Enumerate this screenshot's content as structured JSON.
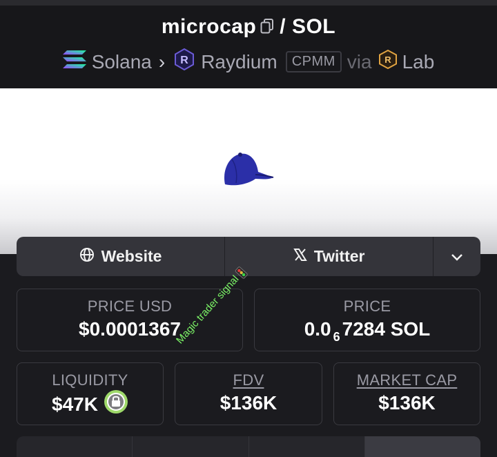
{
  "pair": {
    "base": "microcap",
    "separator": "/",
    "quote": "SOL"
  },
  "breadcrumb": {
    "chain": "Solana",
    "dex": "Raydium",
    "pool_type": "CPMM",
    "via_label": "via",
    "launchpad": "Lab"
  },
  "links": {
    "website_label": "Website",
    "twitter_label": "Twitter"
  },
  "stats": {
    "price_usd": {
      "label": "PRICE USD",
      "value": "$0.0001367"
    },
    "price": {
      "label": "PRICE",
      "value_prefix": "0.0",
      "value_subscript": "6",
      "value_suffix": "7284 SOL"
    },
    "liquidity": {
      "label": "LIQUIDITY",
      "value": "$47K"
    },
    "fdv": {
      "label": "FDV",
      "value": "$136K"
    },
    "market_cap": {
      "label": "MARKET CAP",
      "value": "$136K"
    }
  },
  "watermark": {
    "text": "Magic trader signal"
  },
  "colors": {
    "header_bg": "#17171a",
    "page_bg": "#1b1b1f",
    "lock_badge": "#9ed86a",
    "watermark": "#7cf567",
    "cap": "#2b2fa8"
  }
}
